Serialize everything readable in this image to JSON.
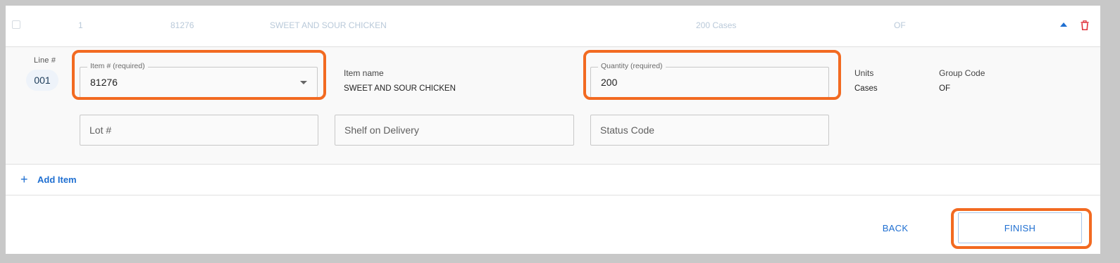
{
  "summary": {
    "line": "1",
    "item_number": "81276",
    "item_name": "SWEET AND SOUR CHICKEN",
    "quantity": "200 Cases",
    "group_code": "OF"
  },
  "details": {
    "line_label": "Line #",
    "line_value": "001",
    "item_field": {
      "legend": "Item # (required)",
      "value": "81276"
    },
    "item_name_label": "Item name",
    "item_name_value": "SWEET AND SOUR CHICKEN",
    "quantity_field": {
      "legend": "Quantity (required)",
      "value": "200"
    },
    "units_label": "Units",
    "units_value": "Cases",
    "group_code_label": "Group Code",
    "group_code_value": "OF",
    "lot_placeholder": "Lot #",
    "shelf_placeholder": "Shelf on Delivery",
    "status_placeholder": "Status Code"
  },
  "add_item": {
    "icon": "+",
    "label": "Add Item"
  },
  "footer": {
    "back_label": "BACK",
    "finish_label": "FINISH"
  },
  "colors": {
    "accent": "#1f6fd1",
    "highlight": "#f26a21",
    "delete": "#e0323c"
  }
}
